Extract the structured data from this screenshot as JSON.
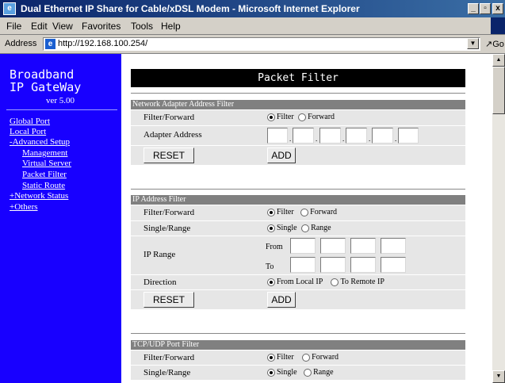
{
  "window": {
    "title": "Dual Ethernet IP Share for Cable/xDSL Modem - Microsoft Internet Explorer",
    "min_glyph": "_",
    "max_glyph": "▫",
    "close_glyph": "x"
  },
  "menu": [
    "File",
    "Edit",
    "View",
    "Favorites",
    "Tools",
    "Help"
  ],
  "address": {
    "label": "Address",
    "url": "http://192.168.100.254/",
    "go": "Go"
  },
  "sidebar": {
    "brand_line1": "Broadband",
    "brand_line2": "IP GateWay",
    "version": "ver 5.00",
    "items": [
      "Global Port",
      "Local Port",
      "-Advanced Setup",
      "Management",
      "Virtual Server",
      "Packet Filter",
      "Static Route",
      "+Network Status",
      "+Others"
    ]
  },
  "page": {
    "title": "Packet Filter",
    "mac_filter": {
      "header": "Network Adapter Address Filter",
      "mode_label": "Filter/Forward",
      "opt_filter": "Filter",
      "opt_forward": "Forward",
      "selected": "Filter",
      "address_label": "Adapter Address",
      "separator": ".",
      "address_values": [
        "",
        "",
        "",
        "",
        "",
        ""
      ],
      "reset": "RESET",
      "add": "ADD"
    },
    "ip_filter": {
      "header": "IP Address Filter",
      "mode_label": "Filter/Forward",
      "opt_filter": "Filter",
      "opt_forward": "Forward",
      "selected_mode": "Filter",
      "sr_label": "Single/Range",
      "opt_single": "Single",
      "opt_range": "Range",
      "selected_sr": "Single",
      "range_label": "IP Range",
      "from": "From",
      "to": "To",
      "from_values": [
        "",
        "",
        "",
        ""
      ],
      "to_values": [
        "",
        "",
        "",
        ""
      ],
      "direction_label": "Direction",
      "opt_local": "From Local IP",
      "opt_remote": "To Remote IP",
      "selected_direction": "From Local IP",
      "reset": "RESET",
      "add": "ADD"
    },
    "port_filter": {
      "header": "TCP/UDP Port Filter",
      "mode_label": "Filter/Forward",
      "opt_filter": "Filter",
      "opt_forward": "Forward",
      "selected_mode": "Filter",
      "sr_label": "Single/Range",
      "opt_single": "Single",
      "opt_range": "Range",
      "selected_sr": "Single"
    }
  }
}
